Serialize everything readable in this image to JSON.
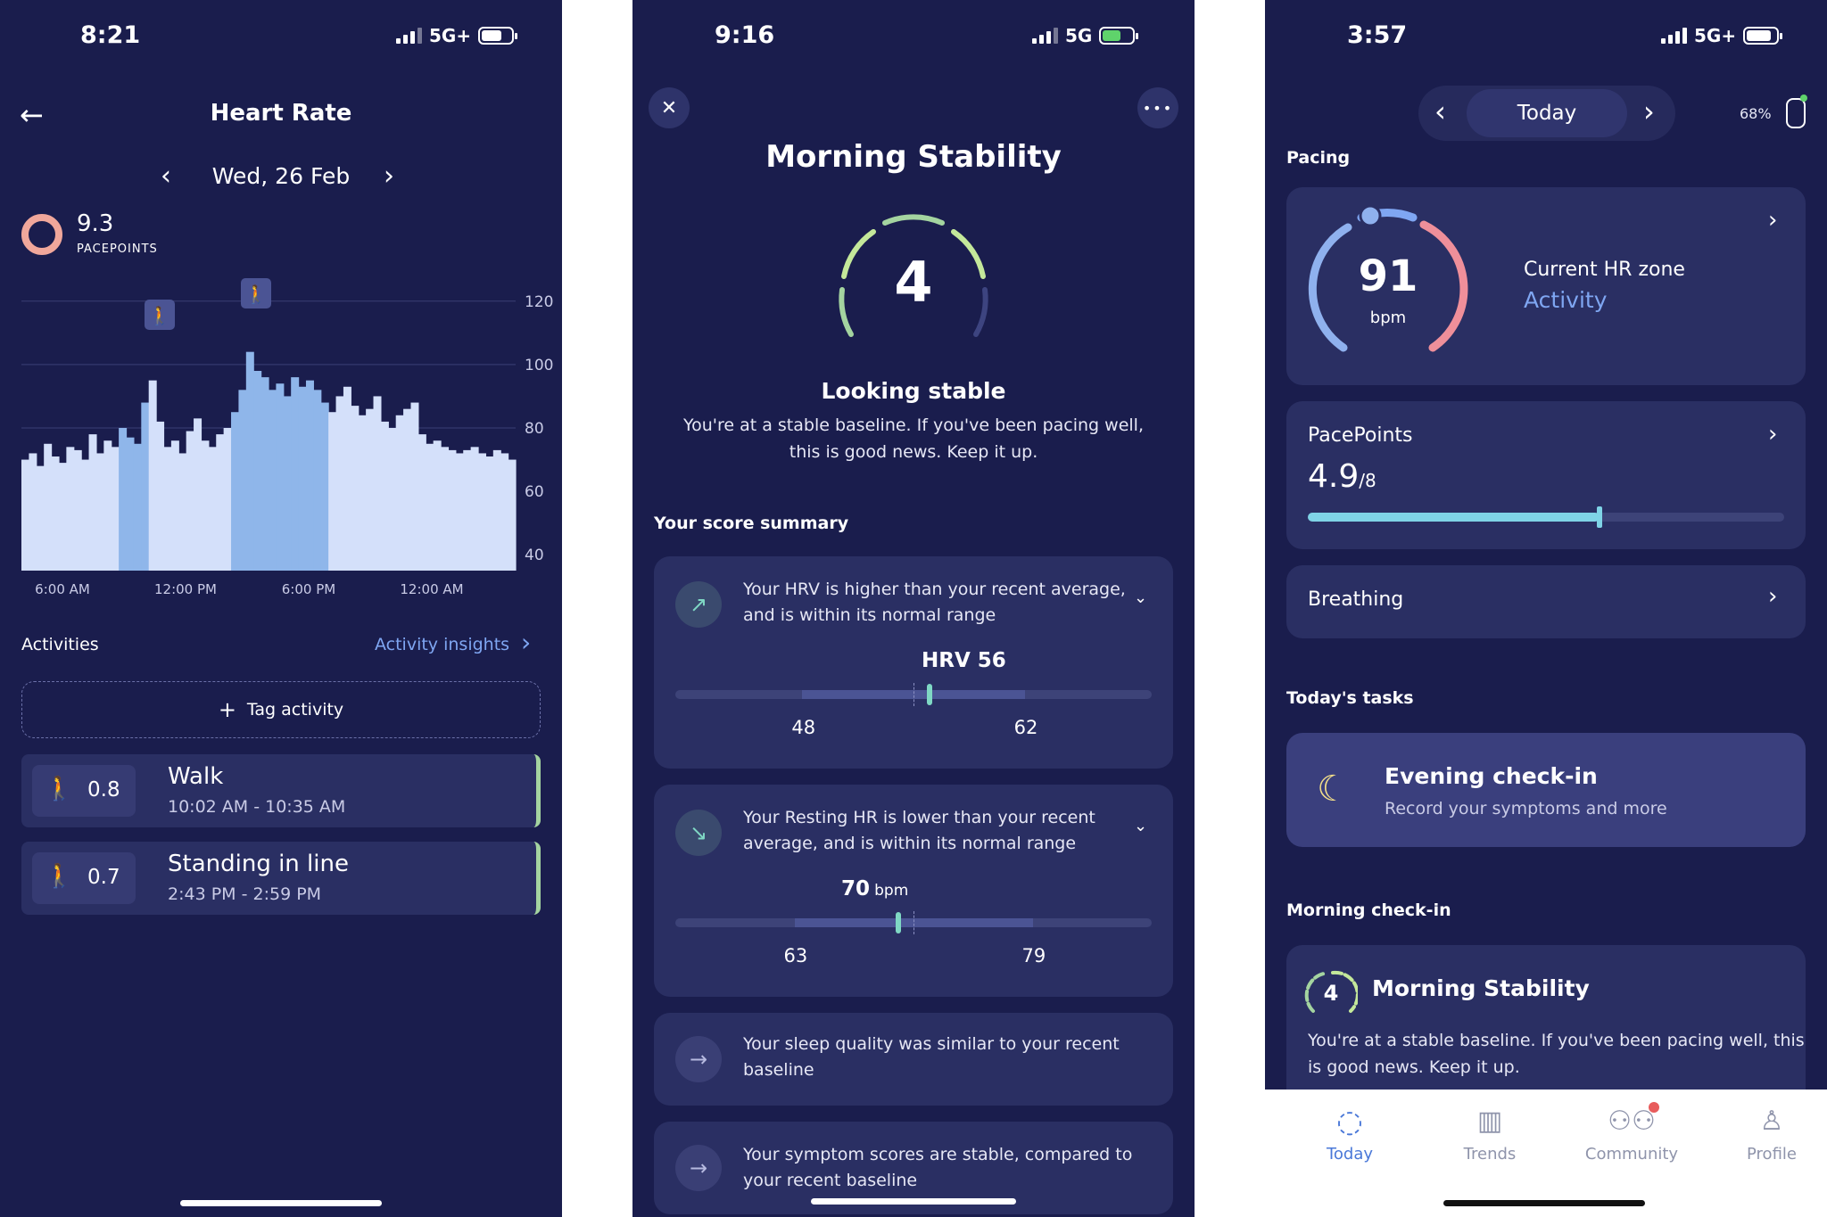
{
  "screen1": {
    "status": {
      "time": "8:21",
      "network": "5G+"
    },
    "title": "Heart Rate",
    "date": "Wed, 26 Feb",
    "pacepoints": {
      "value": "9.3",
      "label": "PACEPOINTS"
    },
    "chart_data": {
      "type": "area",
      "x_ticks": [
        "6:00 AM",
        "12:00 PM",
        "6:00 PM",
        "12:00 AM"
      ],
      "y_ticks": [
        120,
        100,
        80,
        60,
        40
      ],
      "ylim": [
        35,
        125
      ],
      "series": [
        {
          "values": [
            70,
            72,
            68,
            75,
            71,
            69,
            74,
            73,
            70,
            78,
            72,
            76,
            74,
            80,
            77,
            75,
            88,
            95,
            82,
            74,
            76,
            72,
            79,
            83,
            76,
            74,
            78,
            80,
            85,
            92,
            104,
            98,
            96,
            92,
            94,
            90,
            96,
            93,
            95,
            92,
            88,
            85,
            90,
            93,
            87,
            84,
            86,
            90,
            82,
            80,
            84,
            86,
            88,
            78,
            75,
            76,
            74,
            73,
            72,
            73,
            74,
            72,
            71,
            73,
            72,
            70
          ]
        }
      ]
    },
    "activities_label": "Activities",
    "insights_link": "Activity insights",
    "tag_button": "Tag activity",
    "activities": [
      {
        "score": "0.8",
        "name": "Walk",
        "time": "10:02 AM - 10:35 AM"
      },
      {
        "score": "0.7",
        "name": "Standing in line",
        "time": "2:43 PM - 2:59 PM"
      }
    ]
  },
  "screen2": {
    "status": {
      "time": "9:16",
      "network": "5G"
    },
    "title": "Morning Stability",
    "score": "4",
    "headline": "Looking stable",
    "description_line1": "You're at a stable baseline. If you've been pacing well,",
    "description_line2": "this is good news. Keep it up.",
    "summary_label": "Your score summary",
    "hrv": {
      "text_line1": "Your HRV is higher than your recent average,",
      "text_line2": "and is within its normal range",
      "value_label": "HRV 56",
      "low": "48",
      "high": "62",
      "value": 56,
      "range": [
        40,
        70
      ]
    },
    "rhr": {
      "text_line1": "Your Resting HR is lower than your recent",
      "text_line2": "average, and is within its normal range",
      "value": "70",
      "unit": "bpm",
      "low": "63",
      "high": "79",
      "numeric": 70,
      "range": [
        55,
        87
      ]
    },
    "sleep": {
      "text_line1": "Your sleep quality was similar to your recent",
      "text_line2": "baseline"
    },
    "symptoms": {
      "text_line1": "Your symptom scores are stable, compared to",
      "text_line2": "your recent baseline"
    }
  },
  "screen3": {
    "status": {
      "time": "3:57",
      "network": "5G+"
    },
    "nav_label": "Today",
    "battery_pct": "68%",
    "pacing_label": "Pacing",
    "hr": {
      "value": "91",
      "unit": "bpm",
      "zone_label": "Current HR zone",
      "zone": "Activity"
    },
    "pacepoints": {
      "label": "PacePoints",
      "value": "4.9",
      "max": "/8",
      "progress": 0.6125
    },
    "breathing_label": "Breathing",
    "tasks_label": "Today's tasks",
    "evening": {
      "title": "Evening check-in",
      "subtitle": "Record your symptoms and more"
    },
    "morning_label": "Morning check-in",
    "morning": {
      "score": "4",
      "title": "Morning Stability",
      "text_line1": "You're at a stable baseline. If you've been pacing well, this",
      "text_line2": "is good news. Keep it up."
    },
    "tabs": [
      "Today",
      "Trends",
      "Community",
      "Profile"
    ]
  }
}
